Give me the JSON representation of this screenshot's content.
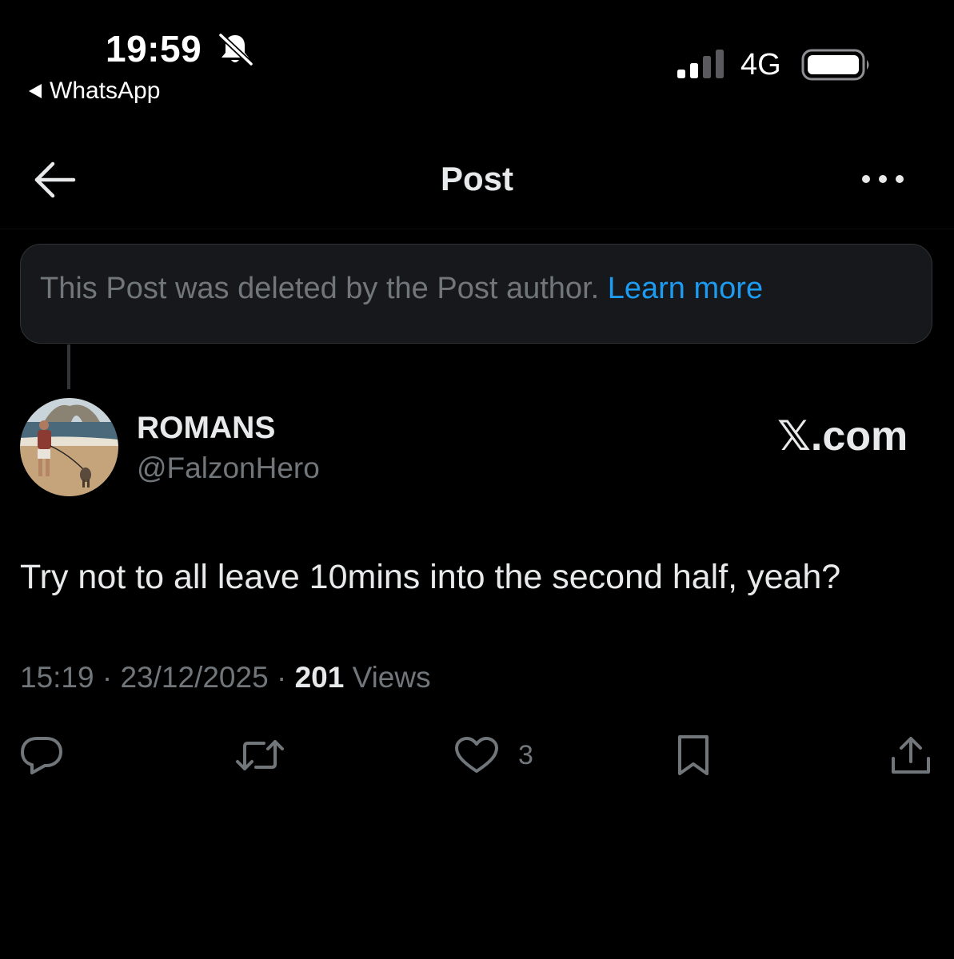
{
  "status_bar": {
    "time": "19:59",
    "back_app": "WhatsApp",
    "network": "4G",
    "icons": [
      "bell-slash-icon",
      "signal-icon",
      "battery-icon"
    ]
  },
  "header": {
    "title": "Post",
    "icons": [
      "back-arrow-icon",
      "more-icon"
    ]
  },
  "deleted_notice": {
    "text": "This Post was deleted by the Post author.",
    "link": "Learn more"
  },
  "author": {
    "name": "ROMANS",
    "handle": "@FalzonHero",
    "watermark_x": "𝕏",
    "watermark_rest": ".com"
  },
  "post": {
    "text": "Try not to all leave 10mins into the second half, yeah?",
    "time": "15:19",
    "date": "23/12/2025",
    "views_count": "201",
    "views_label": "Views"
  },
  "actions": {
    "likes": "3",
    "icons": [
      "reply-icon",
      "repost-icon",
      "like-icon",
      "bookmark-icon",
      "share-icon"
    ]
  },
  "colors": {
    "background": "#000000",
    "text": "#e7e9ea",
    "muted": "#71767b",
    "link": "#1d9bf0",
    "card": "#16181c"
  }
}
